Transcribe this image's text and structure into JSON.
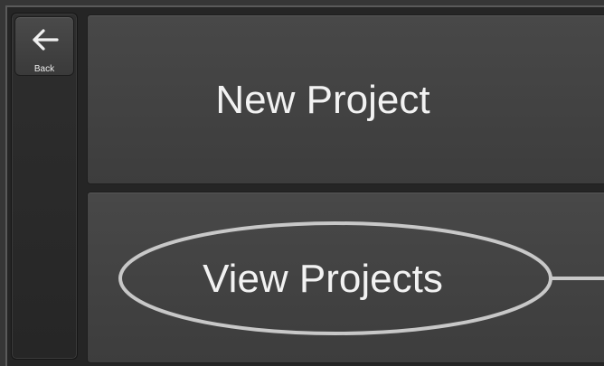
{
  "sidebar": {
    "back_button": {
      "label": "Back",
      "icon": "arrow-left-icon"
    }
  },
  "menu": {
    "new_project_label": "New Project",
    "view_projects_label": "View Projects"
  },
  "annotation": {
    "highlight": "ellipse-callout",
    "color": "#c8c8c8"
  }
}
